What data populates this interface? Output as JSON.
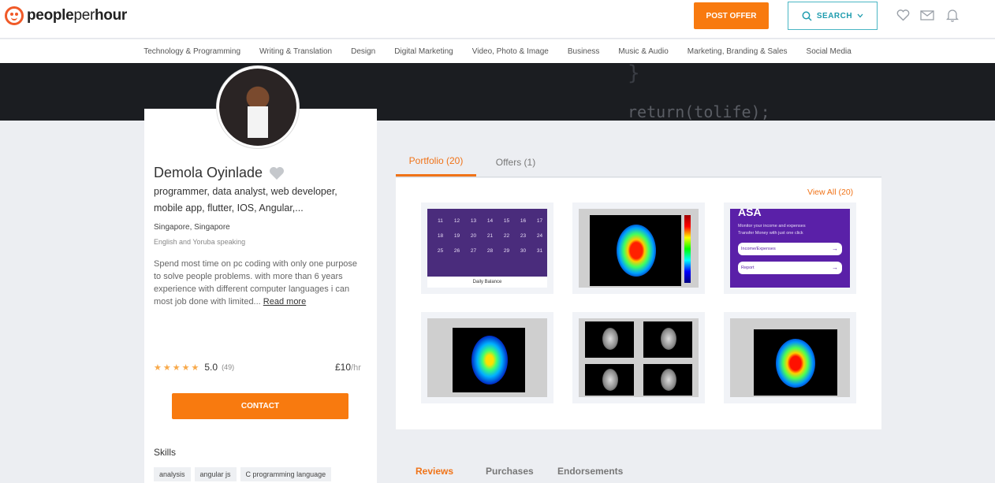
{
  "header": {
    "brand": {
      "bold": "people",
      "light": "per",
      "bold2": "hour"
    },
    "post_offer": "POST OFFER",
    "search": "SEARCH",
    "icons": [
      "heart-icon",
      "mail-icon",
      "bell-icon"
    ]
  },
  "categories": [
    "Technology & Programming",
    "Writing & Translation",
    "Design",
    "Digital Marketing",
    "Video, Photo & Image",
    "Business",
    "Music & Audio",
    "Marketing, Branding & Sales",
    "Social Media"
  ],
  "banner": {
    "code_top": "}",
    "code_bottom": "return(tolife);"
  },
  "profile": {
    "name": "Demola Oyinlade",
    "tagline": "programmer, data analyst, web developer, mobile app, flutter, IOS, Angular,...",
    "location": "Singapore, Singapore",
    "languages": "English and Yoruba speaking",
    "bio": "Spend most time on pc coding with only one purpose to solve people problems. with more than 6 years experience with different computer languages i can most job done with limited... ",
    "read_more": "Read more",
    "rating": "5.0",
    "rating_count": "(49)",
    "stars": 5,
    "price": "£10",
    "price_unit": "/hr",
    "contact": "CONTACT",
    "skills_title": "Skills",
    "skills": [
      "analysis",
      "angular js",
      "C programming language"
    ]
  },
  "tabs": [
    {
      "label": "Portfolio (20)",
      "active": true
    },
    {
      "label": "Offers (1)",
      "active": false
    }
  ],
  "portfolio": {
    "view_all": "View All (20)",
    "calendar_days": [
      "11",
      "12",
      "13",
      "14",
      "15",
      "16",
      "17",
      "18",
      "19",
      "20",
      "21",
      "22",
      "23",
      "24",
      "25",
      "26",
      "27",
      "28",
      "29",
      "30",
      "31"
    ],
    "calendar_footer": "Daily Balance",
    "app_title": "ASA",
    "app_sub1": "Monitor your income and expenses",
    "app_sub2": "Transfer Money with just one click",
    "app_btn1": "Income/Expenses",
    "app_btn2": "Report"
  },
  "bottom_tabs": [
    {
      "label": "Reviews",
      "active": true
    },
    {
      "label": "Purchases",
      "active": false
    },
    {
      "label": "Endorsements",
      "active": false
    }
  ],
  "colors": {
    "accent": "#f87a0f",
    "search": "#1e9cae"
  }
}
